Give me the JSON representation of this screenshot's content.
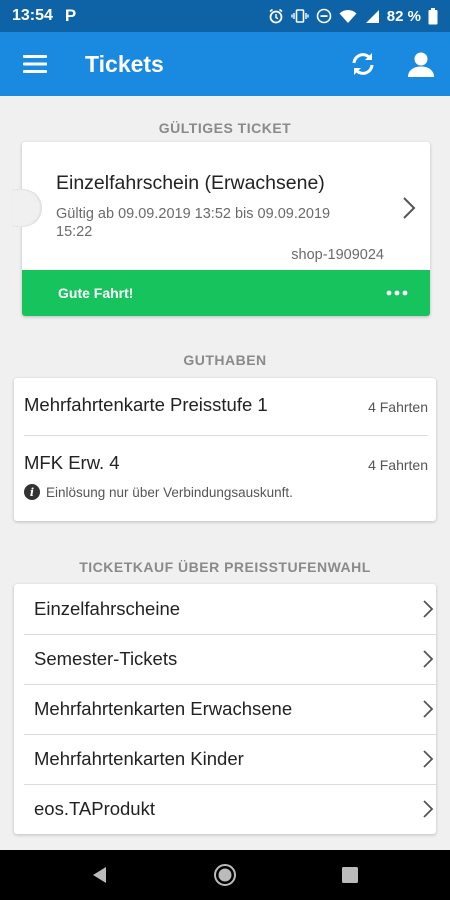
{
  "status_bar": {
    "time": "13:54",
    "notification_app": "P",
    "battery_percent": "82 %"
  },
  "app_bar": {
    "title": "Tickets"
  },
  "valid_ticket": {
    "section_title": "GÜLTIGES TICKET",
    "title": "Einzelfahrschein (Erwachsene)",
    "validity": "Gültig ab 09.09.2019 13:52 bis 09.09.2019 15:22",
    "shop_id": "shop-1909024",
    "footer_text": "Gute Fahrt!",
    "footer_color": "#17c35c"
  },
  "credit": {
    "section_title": "GUTHABEN",
    "items": [
      {
        "name": "Mehrfahrtenkarte Preisstufe 1",
        "count": "4 Fahrten"
      },
      {
        "name": "MFK Erw. 4",
        "count": "4 Fahrten"
      }
    ],
    "note": "Einlösung nur über Verbindungsauskunft."
  },
  "purchase": {
    "section_title": "TICKETKAUF ÜBER PREISSTUFENWAHL",
    "items": [
      {
        "label": "Einzelfahrscheine"
      },
      {
        "label": "Semester-Tickets"
      },
      {
        "label": "Mehrfahrtenkarten Erwachsene"
      },
      {
        "label": "Mehrfahrtenkarten Kinder"
      },
      {
        "label": "eos.TAProdukt"
      }
    ]
  },
  "colors": {
    "status_bar": "#0d63a5",
    "app_bar": "#1a8ae0",
    "accent_green": "#17c35c"
  },
  "icons": [
    "menu-icon",
    "refresh-icon",
    "profile-icon",
    "chevron-right-icon",
    "more-icon",
    "info-icon",
    "back-icon",
    "home-icon",
    "recents-icon"
  ]
}
